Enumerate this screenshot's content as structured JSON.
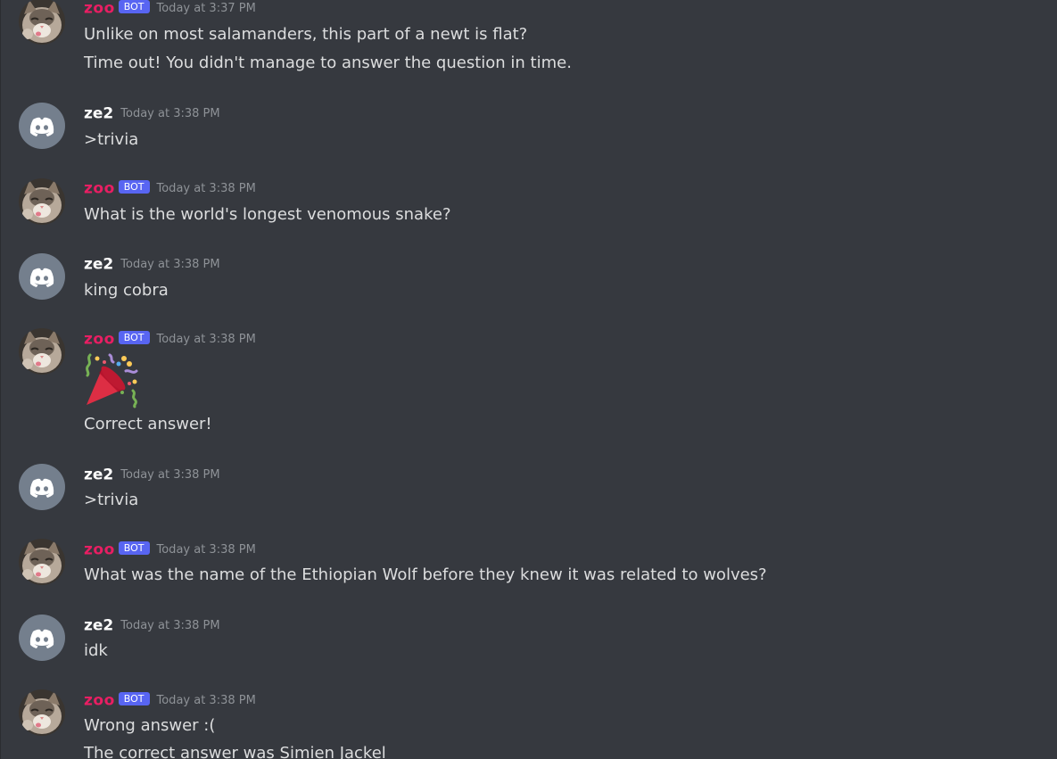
{
  "messages": [
    {
      "author": "zoo",
      "is_bot": true,
      "bot_tag": "BOT",
      "timestamp": "Today at 3:37 PM",
      "lines": [
        "Unlike on most salamanders, this part of a newt is flat?",
        "Time out! You didn't manage to answer the question in time."
      ]
    },
    {
      "author": "ze2",
      "is_bot": false,
      "timestamp": "Today at 3:38 PM",
      "lines": [
        ">trivia"
      ]
    },
    {
      "author": "zoo",
      "is_bot": true,
      "bot_tag": "BOT",
      "timestamp": "Today at 3:38 PM",
      "lines": [
        "What is the world's longest venomous snake?"
      ]
    },
    {
      "author": "ze2",
      "is_bot": false,
      "timestamp": "Today at 3:38 PM",
      "lines": [
        "king cobra"
      ]
    },
    {
      "author": "zoo",
      "is_bot": true,
      "bot_tag": "BOT",
      "timestamp": "Today at 3:38 PM",
      "emoji": "party-popper-emoji",
      "lines": [
        "Correct answer!"
      ]
    },
    {
      "author": "ze2",
      "is_bot": false,
      "timestamp": "Today at 3:38 PM",
      "lines": [
        ">trivia"
      ]
    },
    {
      "author": "zoo",
      "is_bot": true,
      "bot_tag": "BOT",
      "timestamp": "Today at 3:38 PM",
      "lines": [
        "What was the name of the Ethiopian Wolf before they knew it was related to wolves?"
      ]
    },
    {
      "author": "ze2",
      "is_bot": false,
      "timestamp": "Today at 3:38 PM",
      "lines": [
        "idk"
      ]
    },
    {
      "author": "zoo",
      "is_bot": true,
      "bot_tag": "BOT",
      "timestamp": "Today at 3:38 PM",
      "lines": [
        "Wrong answer :(",
        "The correct answer was Simien Jackel"
      ]
    }
  ],
  "colors": {
    "background": "#36393f",
    "bot_name": "#e91e63",
    "bot_tag": "#5865f2",
    "user_name": "#ffffff",
    "message_text": "#dcddde",
    "timestamp": "#8e9297",
    "default_avatar": "#747f8d"
  }
}
